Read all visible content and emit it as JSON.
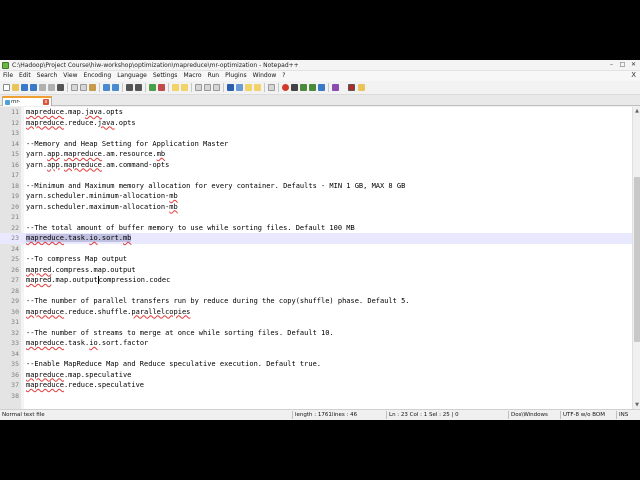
{
  "window": {
    "title": "C:\\Hadoop\\Project Course\\hiw-workshop\\optimization\\mapreduce\\mr-optimization - Notepad++",
    "minimize": "–",
    "maximize": "□",
    "close": "✕"
  },
  "menu": {
    "items": [
      "File",
      "Edit",
      "Search",
      "View",
      "Encoding",
      "Language",
      "Settings",
      "Macro",
      "Run",
      "Plugins",
      "Window",
      "?"
    ],
    "close_doc": "X"
  },
  "tab": {
    "label": "mr-optimization",
    "close": "x"
  },
  "editor": {
    "lines": [
      {
        "n": "11",
        "parts": [
          {
            "t": "mapreduce",
            "sq": true
          },
          {
            "t": ".map."
          },
          {
            "t": "java",
            "sq": true
          },
          {
            "t": ".opts"
          }
        ]
      },
      {
        "n": "12",
        "parts": [
          {
            "t": "mapreduce",
            "sq": true
          },
          {
            "t": ".reduce."
          },
          {
            "t": "java",
            "sq": true
          },
          {
            "t": ".opts"
          }
        ]
      },
      {
        "n": "13",
        "parts": []
      },
      {
        "n": "14",
        "parts": [
          {
            "t": "--Memory and Heap Setting for Application Master"
          }
        ]
      },
      {
        "n": "15",
        "parts": [
          {
            "t": "yarn."
          },
          {
            "t": "app",
            "sq": true
          },
          {
            "t": "."
          },
          {
            "t": "mapreduce",
            "sq": true
          },
          {
            "t": ".am.resource."
          },
          {
            "t": "mb",
            "sq": true
          }
        ]
      },
      {
        "n": "16",
        "parts": [
          {
            "t": "yarn."
          },
          {
            "t": "app",
            "sq": true
          },
          {
            "t": "."
          },
          {
            "t": "mapreduce",
            "sq": true
          },
          {
            "t": ".am.command-opts"
          }
        ]
      },
      {
        "n": "17",
        "parts": []
      },
      {
        "n": "18",
        "parts": [
          {
            "t": "--Minimum and Maximum memory allocation for every container. Defaults - MIN 1 GB, MAX 8 GB"
          }
        ]
      },
      {
        "n": "19",
        "parts": [
          {
            "t": "yarn.scheduler.minimum-allocation-"
          },
          {
            "t": "mb",
            "sq": true
          }
        ]
      },
      {
        "n": "20",
        "parts": [
          {
            "t": "yarn.scheduler.maximum-allocation-"
          },
          {
            "t": "mb",
            "sq": true
          }
        ]
      },
      {
        "n": "21",
        "parts": []
      },
      {
        "n": "22",
        "parts": [
          {
            "t": "--The total amount of buffer memory to use while sorting files. Default 100 MB"
          }
        ]
      },
      {
        "n": "23",
        "current": true,
        "parts": [
          {
            "t": "mapreduce",
            "sq": true,
            "sel": true
          },
          {
            "t": ".task.",
            "sel": true
          },
          {
            "t": "io",
            "sq": true,
            "sel": true
          },
          {
            "t": ".sort.",
            "sel": true
          },
          {
            "t": "mb",
            "sq": true,
            "sel": true
          }
        ]
      },
      {
        "n": "24",
        "parts": []
      },
      {
        "n": "25",
        "parts": [
          {
            "t": "--To compress Map output"
          }
        ]
      },
      {
        "n": "26",
        "parts": [
          {
            "t": "mapred",
            "sq": true
          },
          {
            "t": ".compress.map.output"
          }
        ]
      },
      {
        "n": "27",
        "parts": [
          {
            "t": "mapred",
            "sq": true
          },
          {
            "t": ".map.output"
          },
          {
            "caret": true
          },
          {
            "t": "compression.codec"
          }
        ]
      },
      {
        "n": "28",
        "parts": []
      },
      {
        "n": "29",
        "parts": [
          {
            "t": "--The number of parallel transfers run by reduce during the copy(shuffle) phase. Default 5."
          }
        ]
      },
      {
        "n": "30",
        "parts": [
          {
            "t": "mapreduce",
            "sq": true
          },
          {
            "t": ".reduce.shuffle."
          },
          {
            "t": "parallelcopies",
            "sq": true
          }
        ]
      },
      {
        "n": "31",
        "parts": []
      },
      {
        "n": "32",
        "parts": [
          {
            "t": "--The number of streams to merge at once while sorting files. Default 10."
          }
        ]
      },
      {
        "n": "33",
        "parts": [
          {
            "t": "mapreduce",
            "sq": true
          },
          {
            "t": ".task."
          },
          {
            "t": "io",
            "sq": true
          },
          {
            "t": ".sort.factor"
          }
        ]
      },
      {
        "n": "34",
        "parts": []
      },
      {
        "n": "35",
        "parts": [
          {
            "t": "--Enable MapReduce Map and Reduce speculative execution. Default true."
          }
        ]
      },
      {
        "n": "36",
        "parts": [
          {
            "t": "mapreduce",
            "sq": true
          },
          {
            "t": ".map.speculative"
          }
        ]
      },
      {
        "n": "37",
        "parts": [
          {
            "t": "mapreduce",
            "sq": true
          },
          {
            "t": ".reduce.speculative"
          }
        ]
      },
      {
        "n": "38",
        "parts": []
      }
    ]
  },
  "status": {
    "file_type": "Normal text file",
    "length": "length : 1761",
    "lines": "lines : 46",
    "position": "Ln : 23   Col : 1   Sel : 25 | 0",
    "eol": "Dos\\Windows",
    "encoding": "UTF-8 w/o BOM",
    "mode": "INS"
  },
  "colors": {
    "tab_accent": "#f0a030",
    "current_line": "#e8e8ff",
    "selection": "#c0c0e0",
    "spell_squiggle": "#e23a3a"
  }
}
